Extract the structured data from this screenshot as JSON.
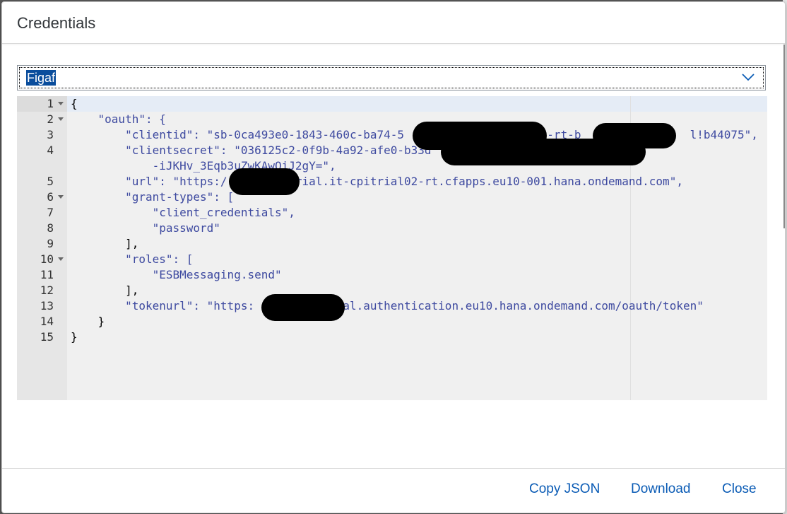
{
  "dialog": {
    "title": "Credentials",
    "selected_service": "Figaf",
    "buttons": {
      "copy": "Copy JSON",
      "download": "Download",
      "close": "Close"
    }
  },
  "editor": {
    "lines": [
      {
        "n": "1",
        "fold": true,
        "t": "{"
      },
      {
        "n": "2",
        "fold": true,
        "t": "    \"oauth\": {"
      },
      {
        "n": "3",
        "fold": false,
        "t": "        \"clientid\": \"sb-0ca493e0-1843-460c-ba74-5                   it-rt-b                l!b44075\","
      },
      {
        "n": "4",
        "fold": false,
        "t": "        \"clientsecret\": \"036125c2-0f9b-4a92-afe0-b33d"
      },
      {
        "n": "",
        "fold": false,
        "t": "            -iJKHv_3Eqb3uZwKAwOiJ2gY=\","
      },
      {
        "n": "5",
        "fold": false,
        "t": "        \"url\": \"https:/          rial.it-cpitrial02-rt.cfapps.eu10-001.hana.ondemand.com\","
      },
      {
        "n": "6",
        "fold": true,
        "t": "        \"grant-types\": ["
      },
      {
        "n": "7",
        "fold": false,
        "t": "            \"client_credentials\","
      },
      {
        "n": "8",
        "fold": false,
        "t": "            \"password\""
      },
      {
        "n": "9",
        "fold": false,
        "t": "        ],"
      },
      {
        "n": "10",
        "fold": true,
        "t": "        \"roles\": ["
      },
      {
        "n": "11",
        "fold": false,
        "t": "            \"ESBMessaging.send\""
      },
      {
        "n": "12",
        "fold": false,
        "t": "        ],"
      },
      {
        "n": "13",
        "fold": false,
        "t": "        \"tokenurl\": \"https:            ial.authentication.eu10.hana.ondemand.com/oauth/token\""
      },
      {
        "n": "14",
        "fold": false,
        "t": "    }"
      },
      {
        "n": "15",
        "fold": false,
        "t": "}"
      }
    ]
  }
}
